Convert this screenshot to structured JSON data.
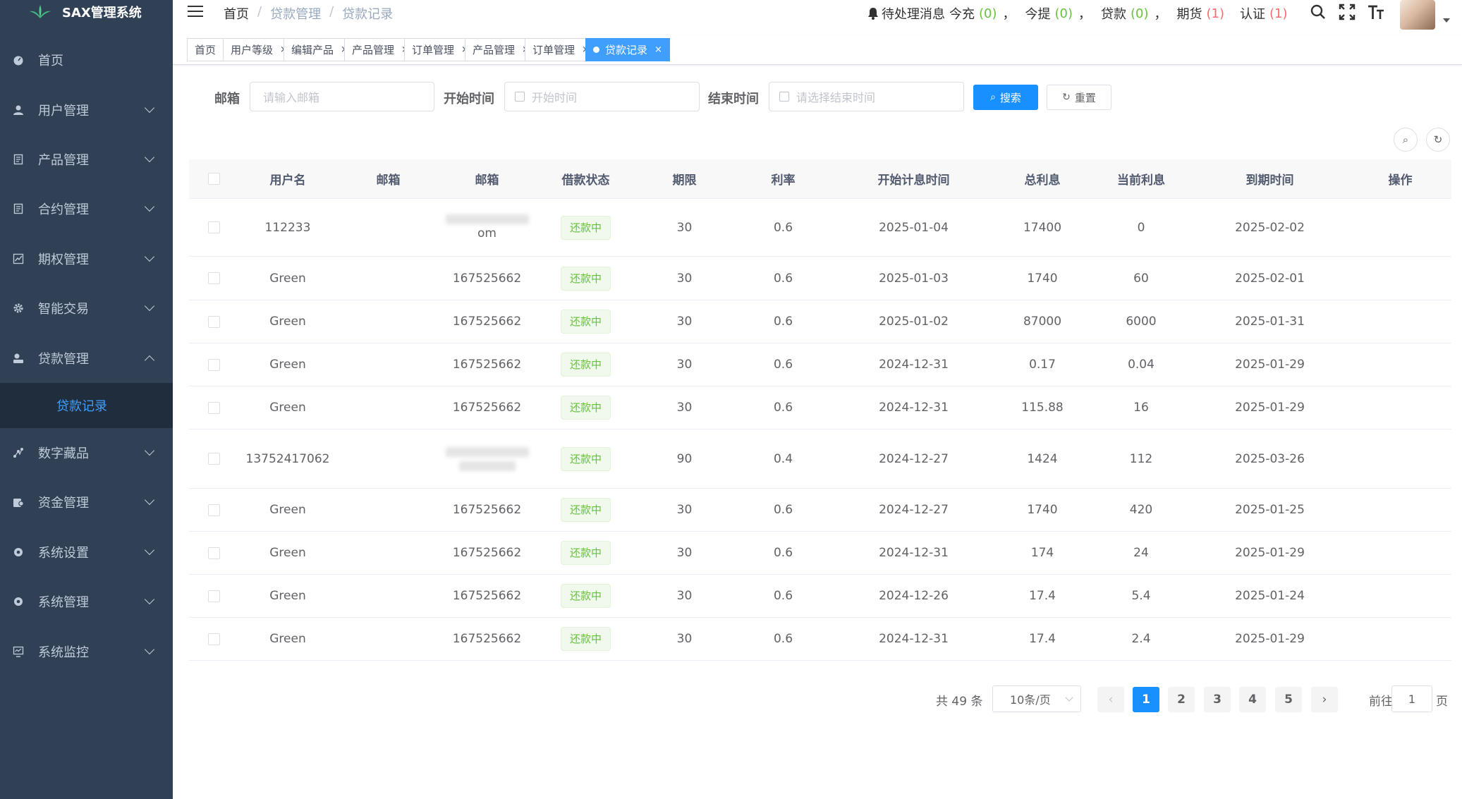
{
  "app": {
    "title": "SAX管理系统"
  },
  "sidebar": {
    "items": [
      {
        "label": "首页",
        "icon": "dashboard-icon",
        "expandable": false
      },
      {
        "label": "用户管理",
        "icon": "user-icon",
        "expandable": true
      },
      {
        "label": "产品管理",
        "icon": "document-icon",
        "expandable": true
      },
      {
        "label": "合约管理",
        "icon": "document-icon",
        "expandable": true
      },
      {
        "label": "期权管理",
        "icon": "chart-icon",
        "expandable": true
      },
      {
        "label": "智能交易",
        "icon": "gear-icon",
        "expandable": true
      },
      {
        "label": "贷款管理",
        "icon": "money-icon",
        "expandable": true,
        "expanded": true
      },
      {
        "label": "数字藏品",
        "icon": "nodes-icon",
        "expandable": true
      },
      {
        "label": "资金管理",
        "icon": "wallet-icon",
        "expandable": true
      },
      {
        "label": "系统设置",
        "icon": "settings-icon",
        "expandable": true
      },
      {
        "label": "系统管理",
        "icon": "settings-icon",
        "expandable": true
      },
      {
        "label": "系统监控",
        "icon": "monitor-icon",
        "expandable": true
      }
    ],
    "submenu_active": "贷款记录"
  },
  "header": {
    "breadcrumb": [
      "首页",
      "贷款管理",
      "贷款记录"
    ],
    "notice": {
      "prefix": "待处理消息",
      "items": [
        {
          "label": "今充",
          "count": "(0)",
          "color": "green"
        },
        {
          "label": "今提",
          "count": "(0)",
          "color": "green"
        },
        {
          "label": "贷款",
          "count": "(0)",
          "color": "green"
        },
        {
          "label": "期货",
          "count": "(1)",
          "color": "red"
        },
        {
          "label": "认证",
          "count": "(1)",
          "color": "red"
        }
      ],
      "sep": "，"
    }
  },
  "tags": [
    {
      "label": "首页",
      "closable": false
    },
    {
      "label": "用户等级",
      "closable": true
    },
    {
      "label": "编辑产品",
      "closable": true
    },
    {
      "label": "产品管理",
      "closable": true
    },
    {
      "label": "订单管理",
      "closable": true
    },
    {
      "label": "产品管理",
      "closable": true
    },
    {
      "label": "订单管理",
      "closable": true
    },
    {
      "label": "贷款记录",
      "closable": true,
      "active": true
    }
  ],
  "tag_close": "×",
  "search": {
    "email_label": "邮箱",
    "email_placeholder": "请输入邮箱",
    "start_label": "开始时间",
    "start_placeholder": "开始时间",
    "end_label": "结束时间",
    "end_placeholder": "请选择结束时间",
    "search_button": "搜索",
    "reset_button": "重置"
  },
  "table": {
    "headers": [
      "用户名",
      "邮箱",
      "邮箱",
      "借款状态",
      "期限",
      "利率",
      "开始计息时间",
      "总利息",
      "当前利息",
      "到期时间",
      "操作"
    ],
    "rows": [
      {
        "user": "112233",
        "mail1": "",
        "mail2": "om",
        "mail2_blurred": true,
        "status": "还款中",
        "term": "30",
        "rate": "0.6",
        "start": "2025-01-04",
        "total": "17400",
        "current": "0",
        "expire": "2025-02-02"
      },
      {
        "user": "Green",
        "mail1": "",
        "mail2": "167525662",
        "status": "还款中",
        "term": "30",
        "rate": "0.6",
        "start": "2025-01-03",
        "total": "1740",
        "current": "60",
        "expire": "2025-02-01"
      },
      {
        "user": "Green",
        "mail1": "",
        "mail2": "167525662",
        "status": "还款中",
        "term": "30",
        "rate": "0.6",
        "start": "2025-01-02",
        "total": "87000",
        "current": "6000",
        "expire": "2025-01-31"
      },
      {
        "user": "Green",
        "mail1": "",
        "mail2": "167525662",
        "status": "还款中",
        "term": "30",
        "rate": "0.6",
        "start": "2024-12-31",
        "total": "0.17",
        "current": "0.04",
        "expire": "2025-01-29"
      },
      {
        "user": "Green",
        "mail1": "",
        "mail2": "167525662",
        "status": "还款中",
        "term": "30",
        "rate": "0.6",
        "start": "2024-12-31",
        "total": "115.88",
        "current": "16",
        "expire": "2025-01-29"
      },
      {
        "user": "13752417062",
        "mail1": "",
        "mail2": "",
        "mail2_blurred": true,
        "status": "还款中",
        "term": "90",
        "rate": "0.4",
        "start": "2024-12-27",
        "total": "1424",
        "current": "112",
        "expire": "2025-03-26"
      },
      {
        "user": "Green",
        "mail1": "",
        "mail2": "167525662",
        "status": "还款中",
        "term": "30",
        "rate": "0.6",
        "start": "2024-12-27",
        "total": "1740",
        "current": "420",
        "expire": "2025-01-25"
      },
      {
        "user": "Green",
        "mail1": "",
        "mail2": "167525662",
        "status": "还款中",
        "term": "30",
        "rate": "0.6",
        "start": "2024-12-31",
        "total": "174",
        "current": "24",
        "expire": "2025-01-29"
      },
      {
        "user": "Green",
        "mail1": "",
        "mail2": "167525662",
        "status": "还款中",
        "term": "30",
        "rate": "0.6",
        "start": "2024-12-26",
        "total": "17.4",
        "current": "5.4",
        "expire": "2025-01-24"
      },
      {
        "user": "Green",
        "mail1": "",
        "mail2": "167525662",
        "status": "还款中",
        "term": "30",
        "rate": "0.6",
        "start": "2024-12-31",
        "total": "17.4",
        "current": "2.4",
        "expire": "2025-01-29"
      }
    ]
  },
  "pagination": {
    "total_text": "共 49 条",
    "page_size": "10条/页",
    "pages": [
      "1",
      "2",
      "3",
      "4",
      "5"
    ],
    "current": "1",
    "prev": "‹",
    "next": "›",
    "goto_label": "前往",
    "goto_value": "1",
    "page_suffix": "页"
  },
  "colors": {
    "sidebar_bg": "#304156",
    "submenu_bg": "#1f2d3d",
    "primary": "#1890ff",
    "success": "#67c23a",
    "danger": "#f56c6c"
  }
}
